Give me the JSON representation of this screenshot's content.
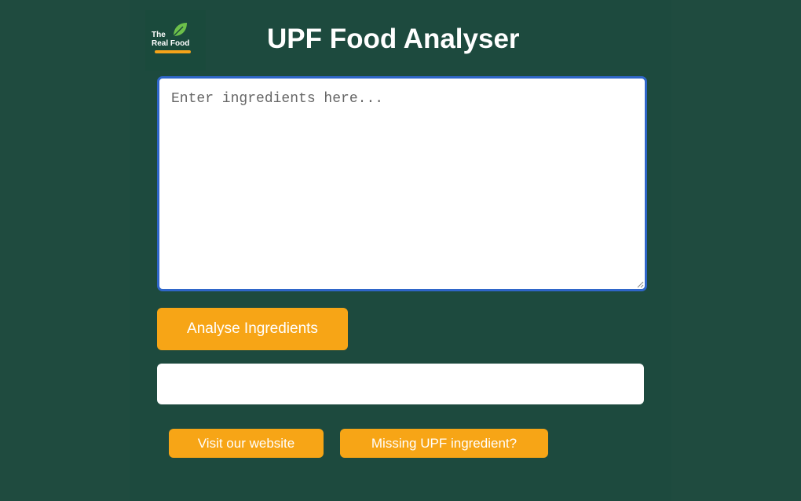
{
  "logo": {
    "line1": "The",
    "line2": "Real Food"
  },
  "title": "UPF Food Analyser",
  "ingredients": {
    "value": "",
    "placeholder": "Enter ingredients here..."
  },
  "analyse_label": "Analyse Ingredients",
  "result": "",
  "links": {
    "visit_label": "Visit our website",
    "missing_label": "Missing UPF ingredient?"
  },
  "colors": {
    "background": "#1f4b3f",
    "accent": "#f7a516",
    "focus_border": "#2f66c9"
  },
  "icons": {
    "logo": "leaf-icon",
    "grip": "resize-grip-icon"
  }
}
